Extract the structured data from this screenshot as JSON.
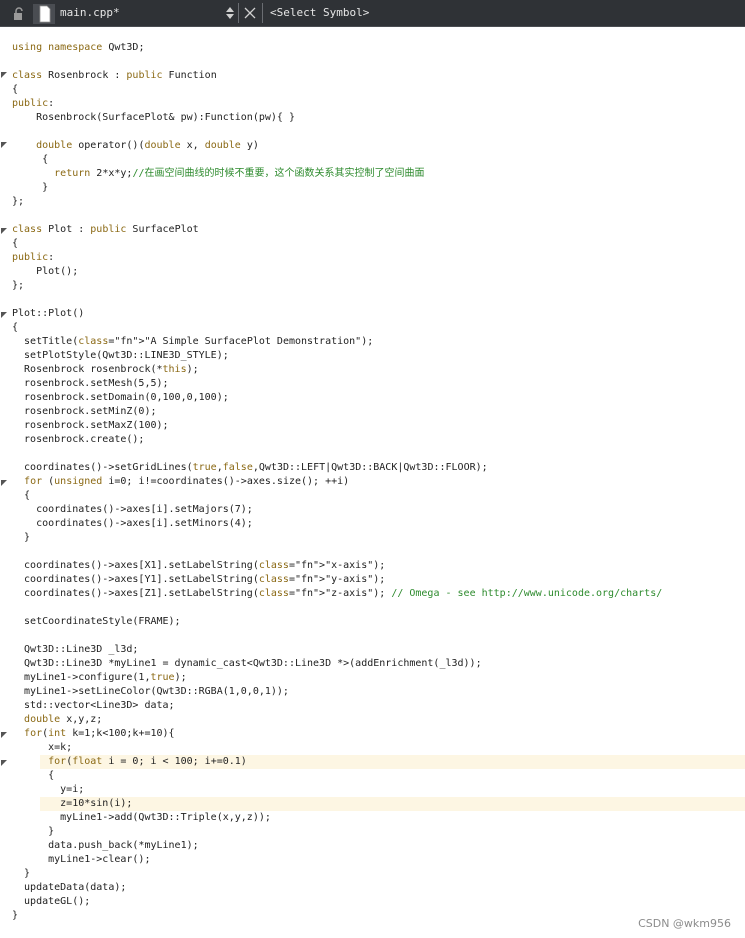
{
  "toolbar": {
    "file_name": "main.cpp*",
    "symbol_selector": "<Select Symbol>"
  },
  "code_lines": [
    "using namespace Qwt3D;",
    "",
    "class Rosenbrock : public Function",
    "{",
    "public:",
    "    Rosenbrock(SurfacePlot& pw):Function(pw){ }",
    "",
    "    double operator()(double x, double y)",
    "     {",
    "       return 2*x*y;//在画空间曲线的时候不重要，这个函数关系其实控制了空间曲面",
    "     }",
    "};",
    "",
    "class Plot : public SurfacePlot",
    "{",
    "public:",
    "    Plot();",
    "};",
    "",
    "Plot::Plot()",
    "{",
    "  setTitle(\"A Simple SurfacePlot Demonstration\");",
    "  setPlotStyle(Qwt3D::LINE3D_STYLE);",
    "  Rosenbrock rosenbrock(*this);",
    "  rosenbrock.setMesh(5,5);",
    "  rosenbrock.setDomain(0,100,0,100);",
    "  rosenbrock.setMinZ(0);",
    "  rosenbrock.setMaxZ(100);",
    "  rosenbrock.create();",
    "",
    "  coordinates()->setGridLines(true,false,Qwt3D::LEFT|Qwt3D::BACK|Qwt3D::FLOOR);",
    "  for (unsigned i=0; i!=coordinates()->axes.size(); ++i)",
    "  {",
    "    coordinates()->axes[i].setMajors(7);",
    "    coordinates()->axes[i].setMinors(4);",
    "  }",
    "",
    "  coordinates()->axes[X1].setLabelString(\"x-axis\");",
    "  coordinates()->axes[Y1].setLabelString(\"y-axis\");",
    "  coordinates()->axes[Z1].setLabelString(\"z-axis\"); // Omega - see http://www.unicode.org/charts/",
    "",
    "  setCoordinateStyle(FRAME);",
    "",
    "  Qwt3D::Line3D _l3d;",
    "  Qwt3D::Line3D *myLine1 = dynamic_cast<Qwt3D::Line3D *>(addEnrichment(_l3d));",
    "  myLine1->configure(1,true);",
    "  myLine1->setLineColor(Qwt3D::RGBA(1,0,0,1));",
    "  std::vector<Line3D> data;",
    "  double x,y,z;",
    "  for(int k=1;k<100;k+=10){",
    "      x=k;",
    "      for(float i = 0; i < 100; i+=0.1)",
    "      {",
    "        y=i;",
    "        z=10*sin(i);",
    "        myLine1->add(Qwt3D::Triple(x,y,z));",
    "      }",
    "      data.push_back(*myLine1);",
    "      myLine1->clear();",
    "  }",
    "  updateData(data);",
    "  updateGL();",
    "}"
  ],
  "watermark": "CSDN @wkm956"
}
